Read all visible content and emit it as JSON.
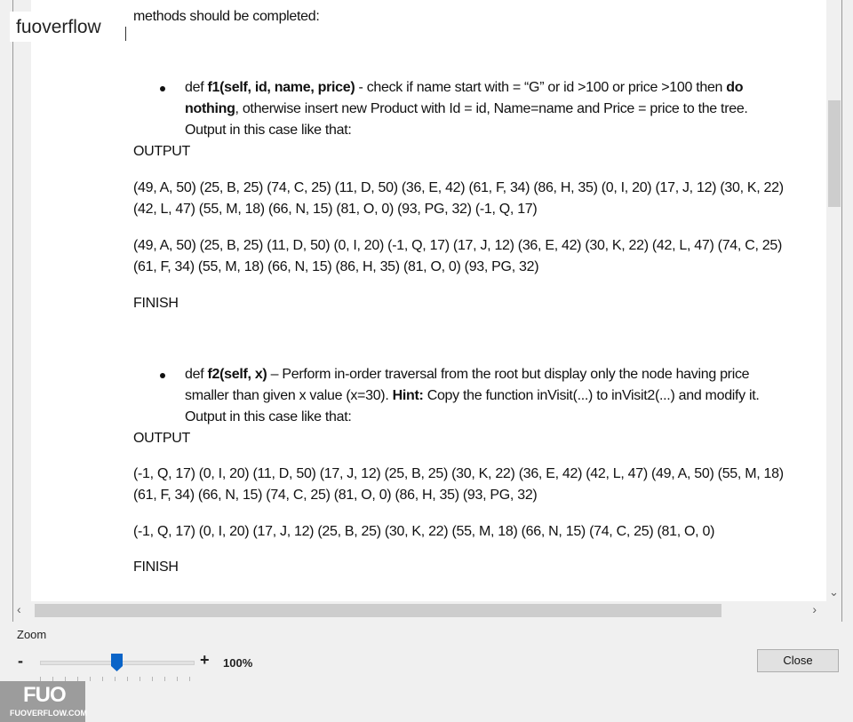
{
  "watermark": {
    "text": "fuoverflow",
    "logo": "FUO",
    "logo_sub": "FUOVERFLOW.COM"
  },
  "document": {
    "intro_cut": "methods should be completed:",
    "f1": {
      "l1_pre": "def ",
      "l1_bold": "f1(self, id, name, price)",
      "l1_post": " - check if name start with = “G” or id >100 or price >100 then ",
      "l1_bold2": "do",
      "l2_bold": "nothing",
      "l2_post": ", otherwise insert new Product with Id = id, Name=name and Price = price to the tree.",
      "l3": "Output in this case like that:"
    },
    "output_label": "OUTPUT",
    "out1_a": "(49, A, 50) (25, B, 25) (74, C, 25) (11, D, 50) (36, E, 42) (61, F, 34) (86, H, 35) (0, I, 20) (17, J, 12) (30, K, 22)",
    "out1_b": "(42, L, 47) (55, M, 18) (66, N, 15) (81, O, 0) (93, PG, 32) (-1, Q, 17)",
    "out2_a": "(49, A, 50) (25, B, 25) (11, D, 50) (0, I, 20) (-1, Q, 17) (17, J, 12) (36, E, 42) (30, K, 22) (42, L, 47) (74, C, 25)",
    "out2_b": "(61, F, 34) (55, M, 18) (66, N, 15) (86, H, 35) (81, O, 0) (93, PG, 32)",
    "finish": "FINISH",
    "f2": {
      "l1_pre": "def ",
      "l1_bold": "f2(self, x)",
      "l1_post": " – Perform in-order traversal from the root but display only the node having price",
      "l2_pre": "smaller than given x value (x=30). ",
      "l2_bold": "Hint:",
      "l2_post": " Copy the function inVisit(...) to inVisit2(...) and modify it.",
      "l3": "Output in this case like that:"
    },
    "out3_a": "(-1, Q, 17) (0, I, 20) (11, D, 50) (17, J, 12) (25, B, 25) (30, K, 22) (36, E, 42) (42, L, 47) (49, A, 50) (55, M, 18)",
    "out3_b": "(61, F, 34) (66, N, 15) (74, C, 25) (81, O, 0) (86, H, 35) (93, PG, 32)",
    "out4": "(-1, Q, 17) (0, I, 20) (17, J, 12) (25, B, 25) (30, K, 22) (55, M, 18) (66, N, 15) (74, C, 25) (81, O, 0)"
  },
  "zoom": {
    "label": "Zoom",
    "minus": "-",
    "plus": "+",
    "value": "100%",
    "level_fraction": 0.5
  },
  "close_label": "Close",
  "icons": {
    "down": "chevron-down-icon",
    "left": "chevron-left-icon",
    "right": "chevron-right-icon"
  }
}
